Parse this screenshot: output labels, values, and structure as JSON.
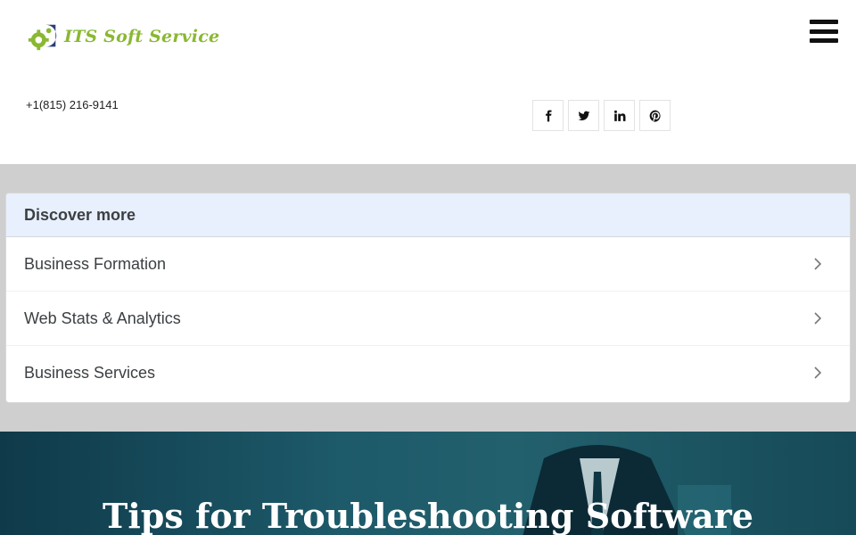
{
  "header": {
    "logo_text": "ITS Soft Service",
    "phone": "+1(815) 216-9141",
    "social": [
      {
        "icon": "facebook-icon"
      },
      {
        "icon": "twitter-icon"
      },
      {
        "icon": "linkedin-icon"
      },
      {
        "icon": "pinterest-icon"
      }
    ]
  },
  "discover": {
    "title": "Discover more",
    "items": [
      {
        "label": "Business Formation"
      },
      {
        "label": "Web Stats & Analytics"
      },
      {
        "label": "Business Services"
      }
    ]
  },
  "hero": {
    "title": "Tips for Troubleshooting Software"
  },
  "colors": {
    "logo_green": "#8ab832",
    "discover_head_bg": "#e8f0fd",
    "band_gray": "#cfcfcf",
    "hero_teal": "#1d5a6a"
  }
}
